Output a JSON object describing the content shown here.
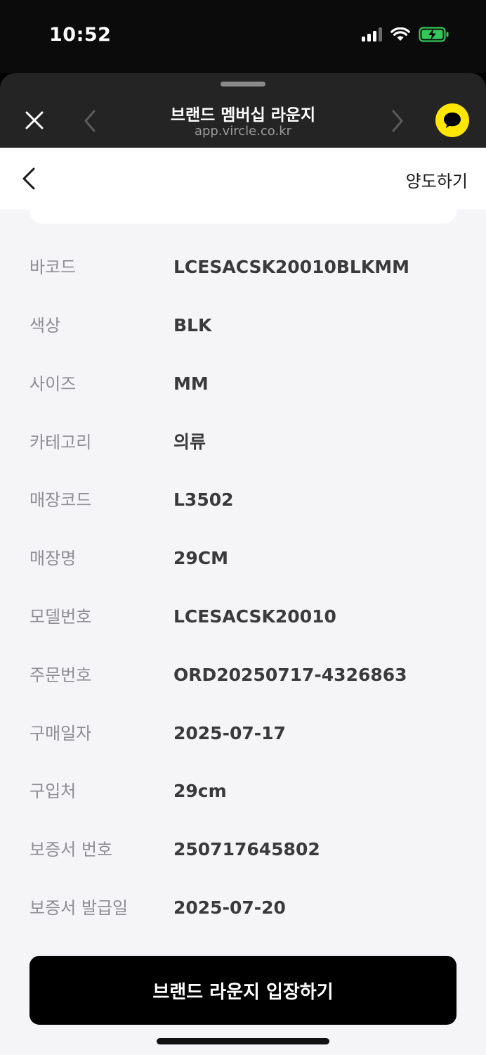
{
  "status": {
    "time": "10:52"
  },
  "sheet": {
    "title": "브랜드 멤버십 라운지",
    "url": "app.vircle.co.kr"
  },
  "nav": {
    "transfer_label": "양도하기"
  },
  "details": [
    {
      "label": "바코드",
      "value": "LCESACSK20010BLKMM"
    },
    {
      "label": "색상",
      "value": "BLK"
    },
    {
      "label": "사이즈",
      "value": "MM"
    },
    {
      "label": "카테고리",
      "value": "의류"
    },
    {
      "label": "매장코드",
      "value": "L3502"
    },
    {
      "label": "매장명",
      "value": "29CM"
    },
    {
      "label": "모델번호",
      "value": "LCESACSK20010"
    },
    {
      "label": "주문번호",
      "value": "ORD20250717-4326863"
    },
    {
      "label": "구매일자",
      "value": "2025-07-17"
    },
    {
      "label": "구입처",
      "value": "29cm"
    },
    {
      "label": "보증서 번호",
      "value": "250717645802"
    },
    {
      "label": "보증서 발급일",
      "value": "2025-07-20"
    }
  ],
  "cta": {
    "label": "브랜드 라운지 입장하기"
  },
  "colors": {
    "accent": "#ffe600",
    "battery": "#34c759"
  },
  "icons": {
    "close": "close-icon",
    "prev": "chevron-left-icon",
    "next": "chevron-right-icon",
    "talk": "chat-bubble-icon",
    "back": "back-arrow-icon"
  }
}
